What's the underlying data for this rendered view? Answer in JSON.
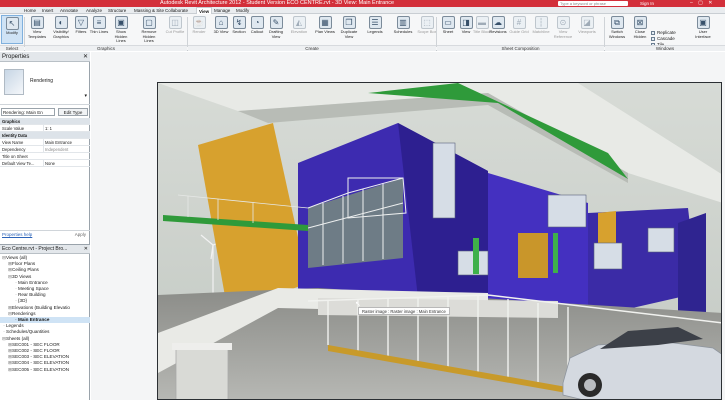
{
  "app": {
    "title": "Autodesk Revit Architecture 2012 - Student Version    ECO CENTRE.rvt - 3D View: Main Entrance",
    "search_placeholder": "Type a keyword or phrase",
    "sign_in": "Sign In",
    "colors": {
      "titlebar": "#d32f3a",
      "building_blue": "#3d2bb0",
      "accent_green": "#2f9a3a",
      "ochre": "#d7a12e"
    }
  },
  "tabs": [
    "Home",
    "Insert",
    "Annotate",
    "Analyze",
    "Structure",
    "Massing & Site",
    "Collaborate",
    "View",
    "Manage",
    "Modify"
  ],
  "ribbon": {
    "select_label": "Select",
    "modify_label": "Modify",
    "graphics_buttons": [
      "View Templates",
      "Visibility/ Graphics",
      "Filters",
      "Thin Lines",
      "Show Hidden Lines",
      "Remove Hidden Lines",
      "Cut Profile"
    ],
    "create_buttons": [
      "Render",
      "3D View",
      "Section",
      "Callout",
      "Drafting View",
      "Elevation",
      "Plan Views",
      "Duplicate View",
      "Legends",
      "Schedules",
      "Scope Box"
    ],
    "sheet_buttons": [
      "Sheet",
      "View",
      "Title Block",
      "Revisions",
      "Guide Grid",
      "Matchline",
      "View Reference",
      "Viewports"
    ],
    "window_buttons": [
      "Switch Windows",
      "Close Hidden",
      "User Interface"
    ],
    "window_list": [
      "Replicate",
      "Cascade",
      "Tile"
    ],
    "groups": {
      "select": "Select",
      "graphics": "Graphics",
      "create": "Create",
      "sheet": "Sheet Composition",
      "windows": "Windows"
    }
  },
  "properties": {
    "title": "Properties",
    "type_name": "Rendering",
    "selector": "Rendering: Main En",
    "edit_type": "Edit Type",
    "rows": [
      {
        "hdr": "Graphics"
      },
      {
        "k": "Scale Value",
        "v": "1:  1"
      },
      {
        "hdr": "Identity Data"
      },
      {
        "k": "View Name",
        "v": "Main Entrance"
      },
      {
        "k": "Dependency",
        "v": "Independent",
        "muted": true
      },
      {
        "k": "Title on Sheet",
        "v": ""
      },
      {
        "k": "Default View Te...",
        "v": "None"
      }
    ],
    "help": "Properties help",
    "apply": "Apply"
  },
  "browser": {
    "title": "Eco Centre.rvt - Project Bro...",
    "tree": [
      {
        "t": "Views (all)",
        "d": 0,
        "tg": "-"
      },
      {
        "t": "Floor Plans",
        "d": 1,
        "tg": "+"
      },
      {
        "t": "Ceiling Plans",
        "d": 1,
        "tg": "+"
      },
      {
        "t": "3D Views",
        "d": 1,
        "tg": "-"
      },
      {
        "t": "Main Entrance",
        "d": 2,
        "tg": ""
      },
      {
        "t": "Meeting Space",
        "d": 2,
        "tg": ""
      },
      {
        "t": "Rear Building",
        "d": 2,
        "tg": ""
      },
      {
        "t": "{3D}",
        "d": 2,
        "tg": ""
      },
      {
        "t": "Elevations (Building Elevatio",
        "d": 1,
        "tg": "+"
      },
      {
        "t": "Renderings",
        "d": 1,
        "tg": "-"
      },
      {
        "t": "Main Entrance",
        "d": 2,
        "tg": "",
        "hl": true
      },
      {
        "t": "Legends",
        "d": 0,
        "tg": ""
      },
      {
        "t": "Schedules/Quantities",
        "d": 0,
        "tg": ""
      },
      {
        "t": "Sheets (all)",
        "d": 0,
        "tg": "-"
      },
      {
        "t": "SEC001 - SEC FLOOR",
        "d": 1,
        "tg": "+"
      },
      {
        "t": "SEC002 - SEC FLOOR",
        "d": 1,
        "tg": "+"
      },
      {
        "t": "SEC003 - SEC ELEVATION",
        "d": 1,
        "tg": "+"
      },
      {
        "t": "SEC004 - SEC ELEVATION",
        "d": 1,
        "tg": "+"
      },
      {
        "t": "SEC005 - SEC ELEVATION",
        "d": 1,
        "tg": "+"
      }
    ]
  },
  "viewport": {
    "tooltip": "Raster image : Raster image : Main Entrance"
  }
}
